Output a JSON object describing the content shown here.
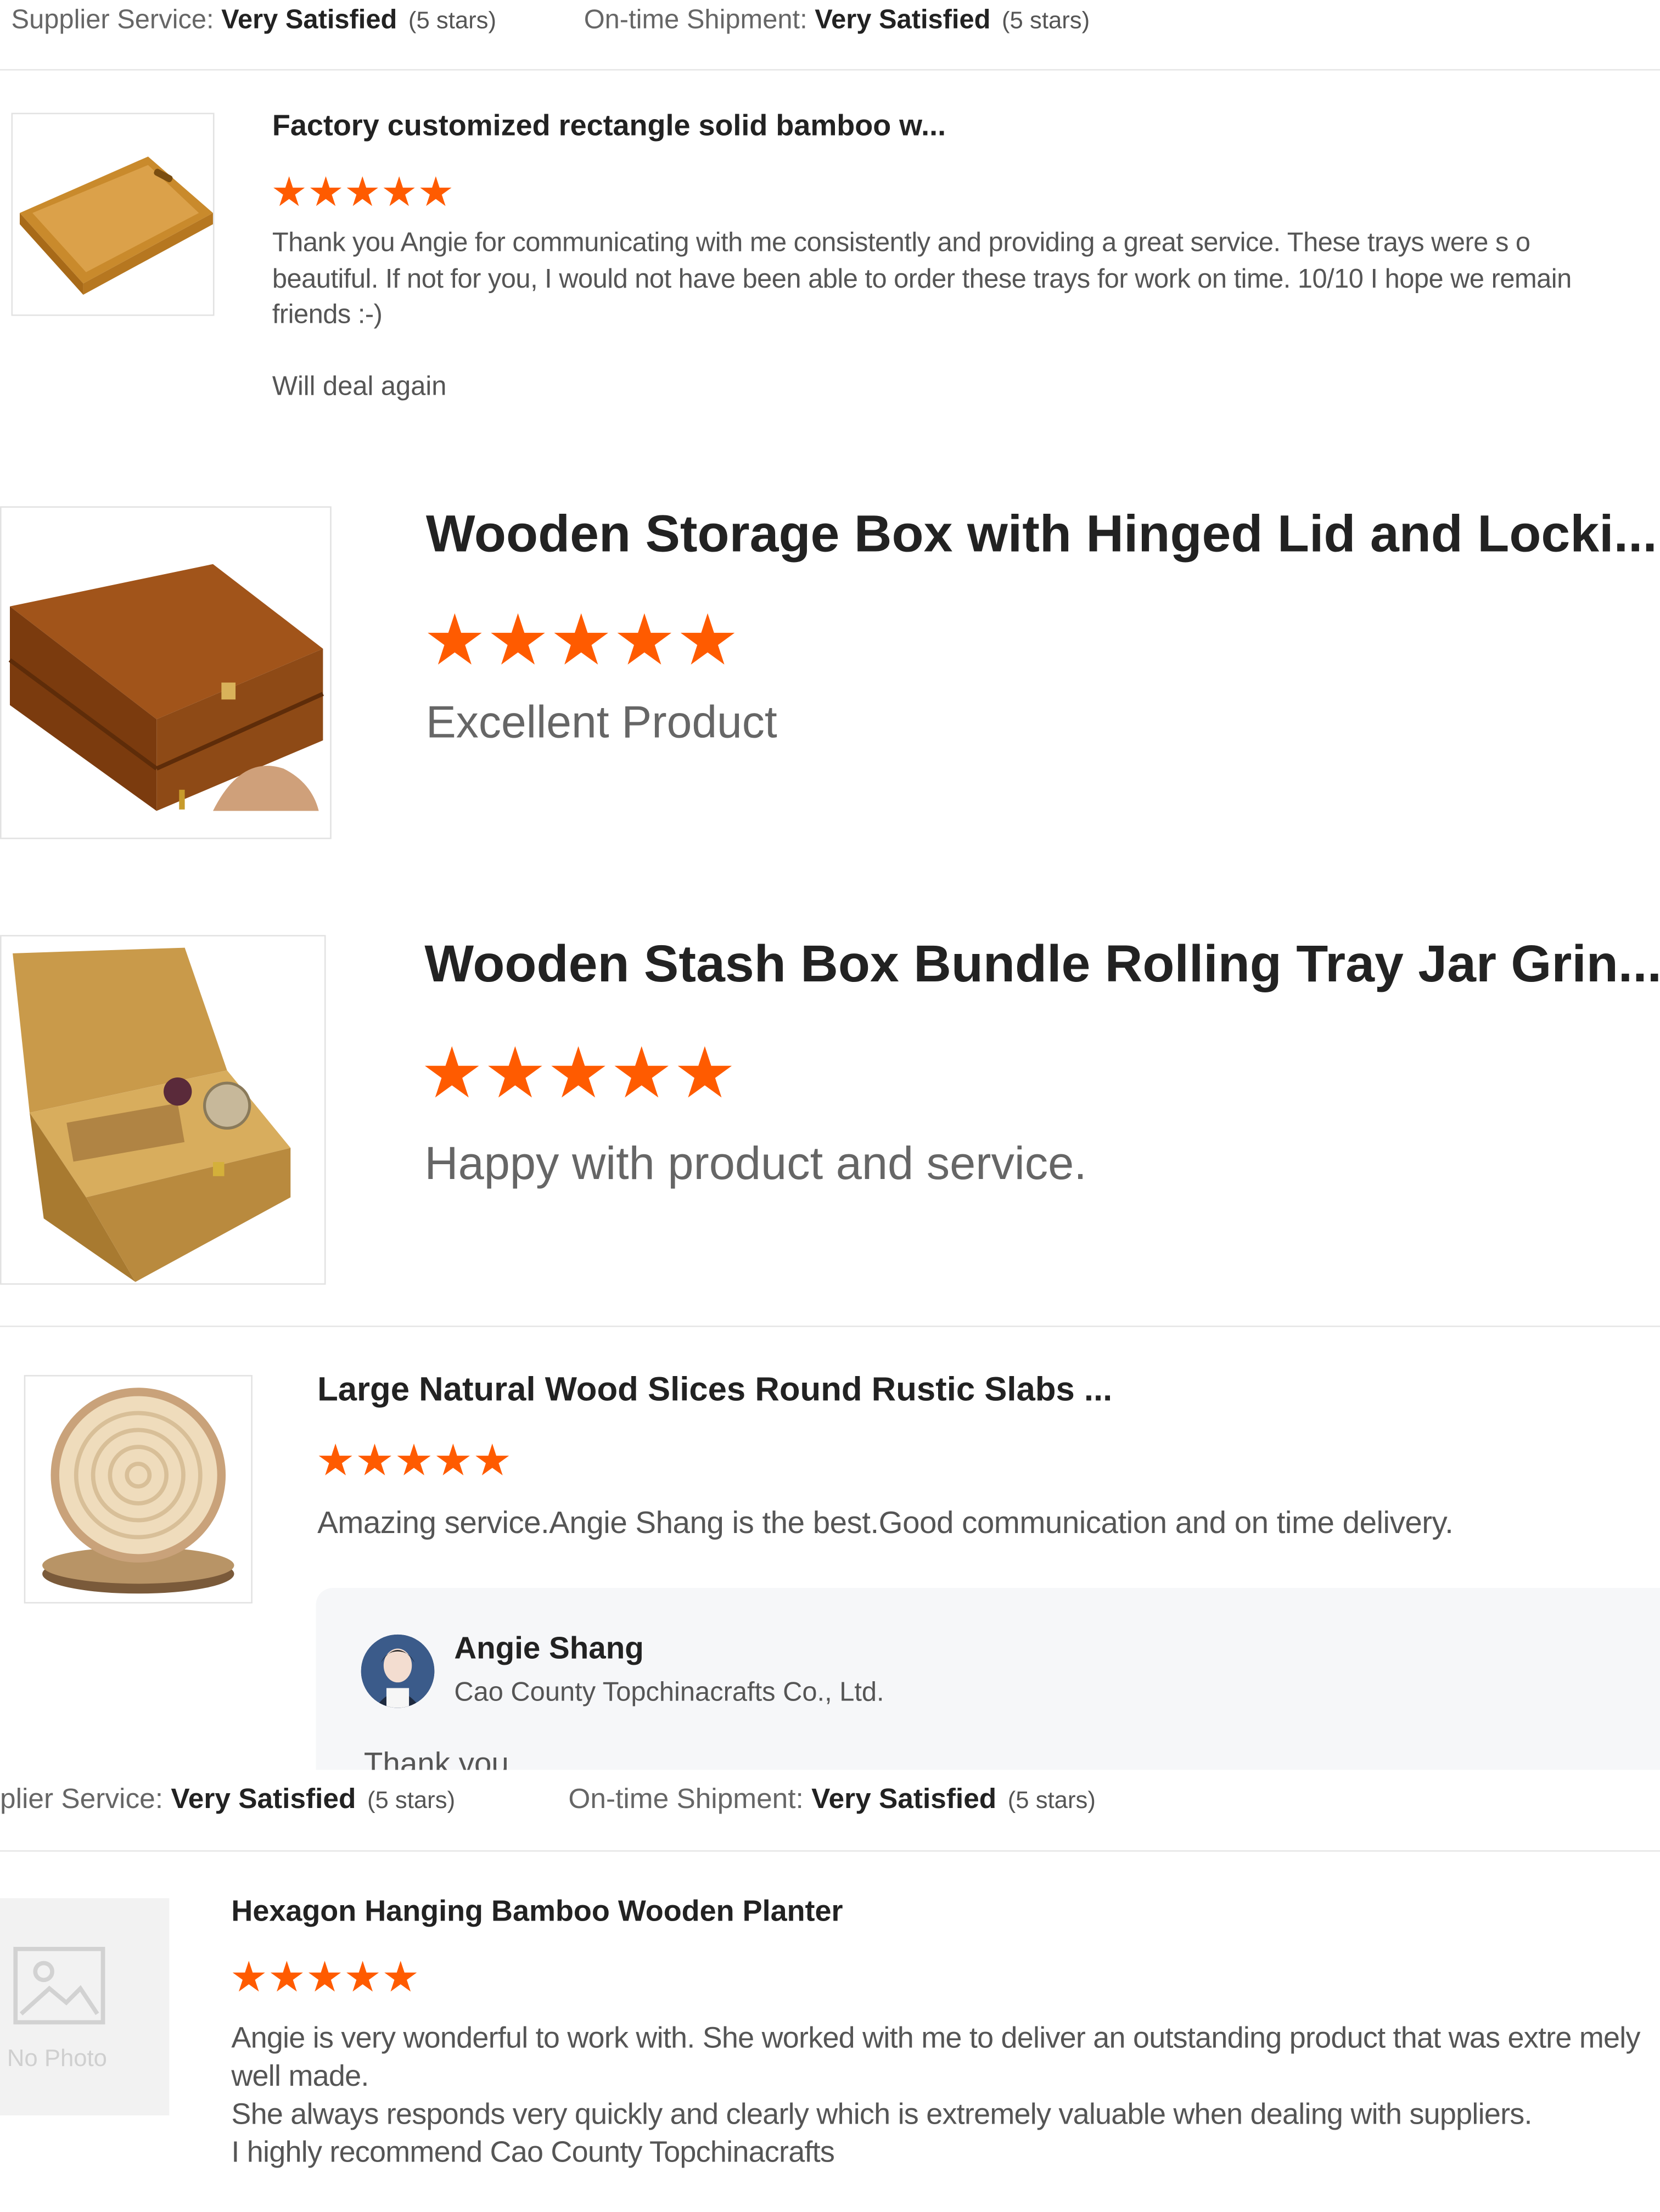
{
  "ratings": [
    {
      "supplier_service_label": "Supplier Service:",
      "supplier_service_value": "Very Satisfied",
      "supplier_service_stars": "(5 stars)",
      "shipment_label": "On-time Shipment:",
      "shipment_value": "Very Satisfied",
      "shipment_stars": "(5 stars)"
    },
    {
      "supplier_service_label": "plier Service:",
      "supplier_service_value": "Very Satisfied",
      "supplier_service_stars": "(5 stars)",
      "shipment_label": "On-time Shipment:",
      "shipment_value": "Very Satisfied",
      "shipment_stars": "(5 stars)"
    }
  ],
  "reviews": [
    {
      "title": "Factory customized rectangle solid bamboo w...",
      "stars": "★★★★★",
      "rating": 5,
      "text": "Thank you Angie for communicating with me consistently and providing a great service. These trays were s o beautiful. If not for you, I would not have been able to order these trays for work on time. 10/10 I hope we remain friends :-)",
      "tag": "Will deal again"
    },
    {
      "title": "Wooden Storage Box with Hinged Lid and Locki...",
      "stars": "★★★★★",
      "rating": 5,
      "text": "Excellent Product"
    },
    {
      "title": "Wooden Stash Box Bundle Rolling Tray Jar Grin...",
      "stars": "★★★★★",
      "rating": 5,
      "text": "Happy with product and service."
    },
    {
      "title": "Large Natural Wood Slices Round Rustic Slabs ...",
      "stars": "★★★★★",
      "rating": 5,
      "text": "Amazing service.Angie Shang is the best.Good communication and on time delivery.",
      "reply": {
        "name": "Angie Shang",
        "company": "Cao County Topchinacrafts Co., Ltd.",
        "text": "Thank you"
      }
    },
    {
      "title": "Hexagon Hanging Bamboo Wooden Planter",
      "stars": "★★★★★",
      "rating": 5,
      "no_photo_label": "No Photo",
      "text_lines": [
        "Angie is very wonderful to work with. She worked with me to deliver an outstanding product that was extre mely well made.",
        "She always responds very quickly and clearly which is extremely valuable when dealing with suppliers.",
        "I highly recommend Cao County Topchinacrafts"
      ]
    }
  ],
  "colors": {
    "star": "#ff5b00",
    "title": "#222222",
    "body": "#555555",
    "divider": "#e6e6e6"
  }
}
